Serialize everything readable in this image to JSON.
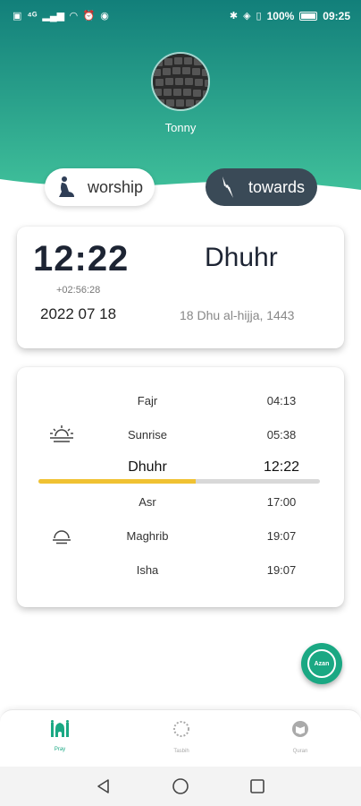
{
  "status_bar": {
    "left_icons": [
      "HD",
      "⁴ᴳ",
      "▮▮▮",
      "wifi",
      "alarm",
      "app"
    ],
    "battery": "100%",
    "time": "09:25"
  },
  "profile": {
    "name": "Tonny"
  },
  "tabs": {
    "worship": "worship",
    "towards": "towards"
  },
  "time_card": {
    "clock": "12:22",
    "offset": "+02:56:28",
    "gregorian_date": "2022 07 18",
    "current_prayer": "Dhuhr",
    "hijri_date": "18 Dhu al-hijja, 1443"
  },
  "prayers": [
    {
      "name": "Fajr",
      "time": "04:13",
      "icon": ""
    },
    {
      "name": "Sunrise",
      "time": "05:38",
      "icon": "sunrise-icon"
    },
    {
      "name": "Dhuhr",
      "time": "12:22",
      "icon": "",
      "current": true
    },
    {
      "name": "Asr",
      "time": "17:00",
      "icon": ""
    },
    {
      "name": "Maghrib",
      "time": "19:07",
      "icon": "sunset-icon"
    },
    {
      "name": "Isha",
      "time": "19:07",
      "icon": ""
    }
  ],
  "progress": {
    "fraction": 0.56,
    "color": "#f0c232"
  },
  "fab": {
    "label": "Azan"
  },
  "bottom_nav": [
    {
      "label": "Pray",
      "icon": "mosque-icon",
      "active": true
    },
    {
      "label": "Tasbih",
      "icon": "tasbih-icon",
      "active": false
    },
    {
      "label": "Quran",
      "icon": "quran-icon",
      "active": false
    }
  ],
  "colors": {
    "header_top": "#127f7a",
    "header_bottom": "#3fbf9a",
    "accent": "#1aa883"
  }
}
